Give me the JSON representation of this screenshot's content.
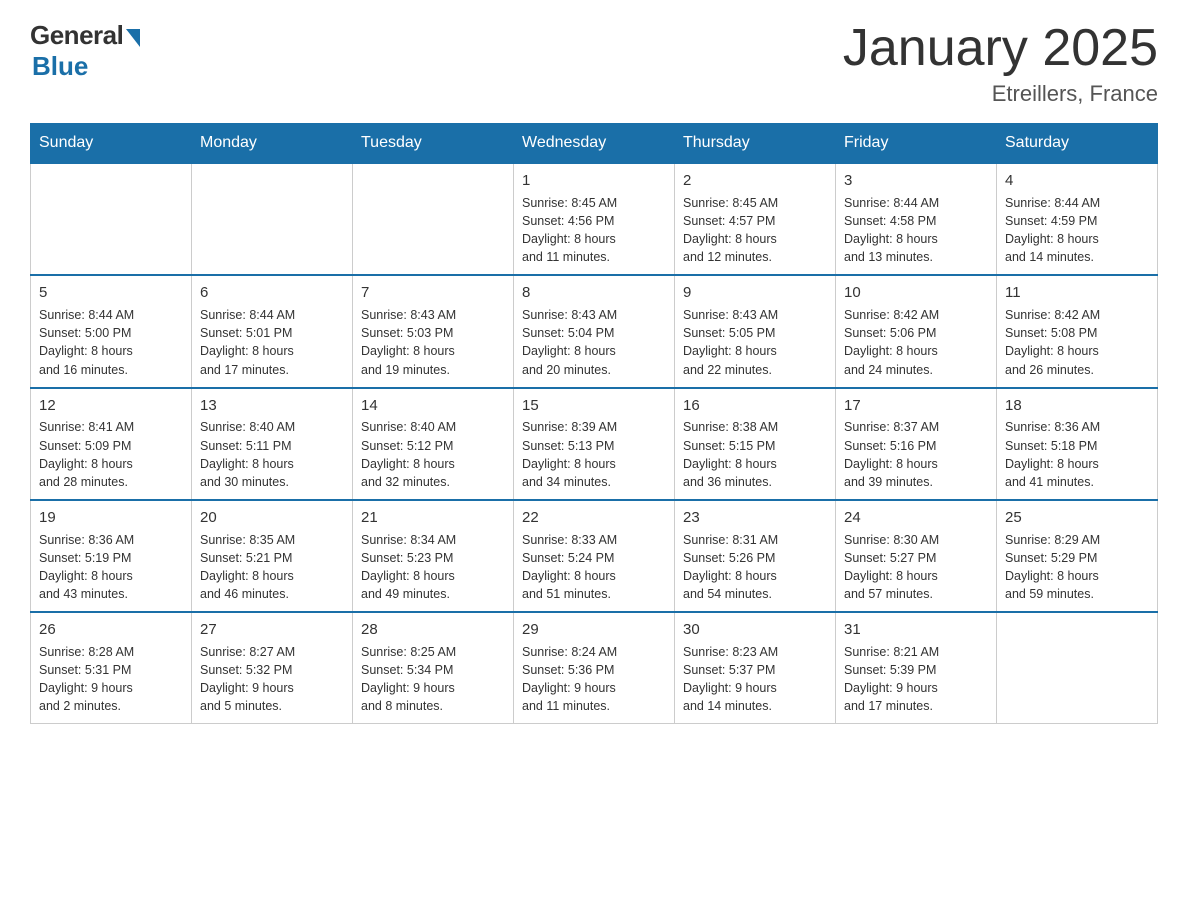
{
  "logo": {
    "general": "General",
    "blue": "Blue"
  },
  "header": {
    "title": "January 2025",
    "subtitle": "Etreillers, France"
  },
  "weekdays": [
    "Sunday",
    "Monday",
    "Tuesday",
    "Wednesday",
    "Thursday",
    "Friday",
    "Saturday"
  ],
  "weeks": [
    [
      {
        "day": "",
        "info": ""
      },
      {
        "day": "",
        "info": ""
      },
      {
        "day": "",
        "info": ""
      },
      {
        "day": "1",
        "info": "Sunrise: 8:45 AM\nSunset: 4:56 PM\nDaylight: 8 hours\nand 11 minutes."
      },
      {
        "day": "2",
        "info": "Sunrise: 8:45 AM\nSunset: 4:57 PM\nDaylight: 8 hours\nand 12 minutes."
      },
      {
        "day": "3",
        "info": "Sunrise: 8:44 AM\nSunset: 4:58 PM\nDaylight: 8 hours\nand 13 minutes."
      },
      {
        "day": "4",
        "info": "Sunrise: 8:44 AM\nSunset: 4:59 PM\nDaylight: 8 hours\nand 14 minutes."
      }
    ],
    [
      {
        "day": "5",
        "info": "Sunrise: 8:44 AM\nSunset: 5:00 PM\nDaylight: 8 hours\nand 16 minutes."
      },
      {
        "day": "6",
        "info": "Sunrise: 8:44 AM\nSunset: 5:01 PM\nDaylight: 8 hours\nand 17 minutes."
      },
      {
        "day": "7",
        "info": "Sunrise: 8:43 AM\nSunset: 5:03 PM\nDaylight: 8 hours\nand 19 minutes."
      },
      {
        "day": "8",
        "info": "Sunrise: 8:43 AM\nSunset: 5:04 PM\nDaylight: 8 hours\nand 20 minutes."
      },
      {
        "day": "9",
        "info": "Sunrise: 8:43 AM\nSunset: 5:05 PM\nDaylight: 8 hours\nand 22 minutes."
      },
      {
        "day": "10",
        "info": "Sunrise: 8:42 AM\nSunset: 5:06 PM\nDaylight: 8 hours\nand 24 minutes."
      },
      {
        "day": "11",
        "info": "Sunrise: 8:42 AM\nSunset: 5:08 PM\nDaylight: 8 hours\nand 26 minutes."
      }
    ],
    [
      {
        "day": "12",
        "info": "Sunrise: 8:41 AM\nSunset: 5:09 PM\nDaylight: 8 hours\nand 28 minutes."
      },
      {
        "day": "13",
        "info": "Sunrise: 8:40 AM\nSunset: 5:11 PM\nDaylight: 8 hours\nand 30 minutes."
      },
      {
        "day": "14",
        "info": "Sunrise: 8:40 AM\nSunset: 5:12 PM\nDaylight: 8 hours\nand 32 minutes."
      },
      {
        "day": "15",
        "info": "Sunrise: 8:39 AM\nSunset: 5:13 PM\nDaylight: 8 hours\nand 34 minutes."
      },
      {
        "day": "16",
        "info": "Sunrise: 8:38 AM\nSunset: 5:15 PM\nDaylight: 8 hours\nand 36 minutes."
      },
      {
        "day": "17",
        "info": "Sunrise: 8:37 AM\nSunset: 5:16 PM\nDaylight: 8 hours\nand 39 minutes."
      },
      {
        "day": "18",
        "info": "Sunrise: 8:36 AM\nSunset: 5:18 PM\nDaylight: 8 hours\nand 41 minutes."
      }
    ],
    [
      {
        "day": "19",
        "info": "Sunrise: 8:36 AM\nSunset: 5:19 PM\nDaylight: 8 hours\nand 43 minutes."
      },
      {
        "day": "20",
        "info": "Sunrise: 8:35 AM\nSunset: 5:21 PM\nDaylight: 8 hours\nand 46 minutes."
      },
      {
        "day": "21",
        "info": "Sunrise: 8:34 AM\nSunset: 5:23 PM\nDaylight: 8 hours\nand 49 minutes."
      },
      {
        "day": "22",
        "info": "Sunrise: 8:33 AM\nSunset: 5:24 PM\nDaylight: 8 hours\nand 51 minutes."
      },
      {
        "day": "23",
        "info": "Sunrise: 8:31 AM\nSunset: 5:26 PM\nDaylight: 8 hours\nand 54 minutes."
      },
      {
        "day": "24",
        "info": "Sunrise: 8:30 AM\nSunset: 5:27 PM\nDaylight: 8 hours\nand 57 minutes."
      },
      {
        "day": "25",
        "info": "Sunrise: 8:29 AM\nSunset: 5:29 PM\nDaylight: 8 hours\nand 59 minutes."
      }
    ],
    [
      {
        "day": "26",
        "info": "Sunrise: 8:28 AM\nSunset: 5:31 PM\nDaylight: 9 hours\nand 2 minutes."
      },
      {
        "day": "27",
        "info": "Sunrise: 8:27 AM\nSunset: 5:32 PM\nDaylight: 9 hours\nand 5 minutes."
      },
      {
        "day": "28",
        "info": "Sunrise: 8:25 AM\nSunset: 5:34 PM\nDaylight: 9 hours\nand 8 minutes."
      },
      {
        "day": "29",
        "info": "Sunrise: 8:24 AM\nSunset: 5:36 PM\nDaylight: 9 hours\nand 11 minutes."
      },
      {
        "day": "30",
        "info": "Sunrise: 8:23 AM\nSunset: 5:37 PM\nDaylight: 9 hours\nand 14 minutes."
      },
      {
        "day": "31",
        "info": "Sunrise: 8:21 AM\nSunset: 5:39 PM\nDaylight: 9 hours\nand 17 minutes."
      },
      {
        "day": "",
        "info": ""
      }
    ]
  ]
}
